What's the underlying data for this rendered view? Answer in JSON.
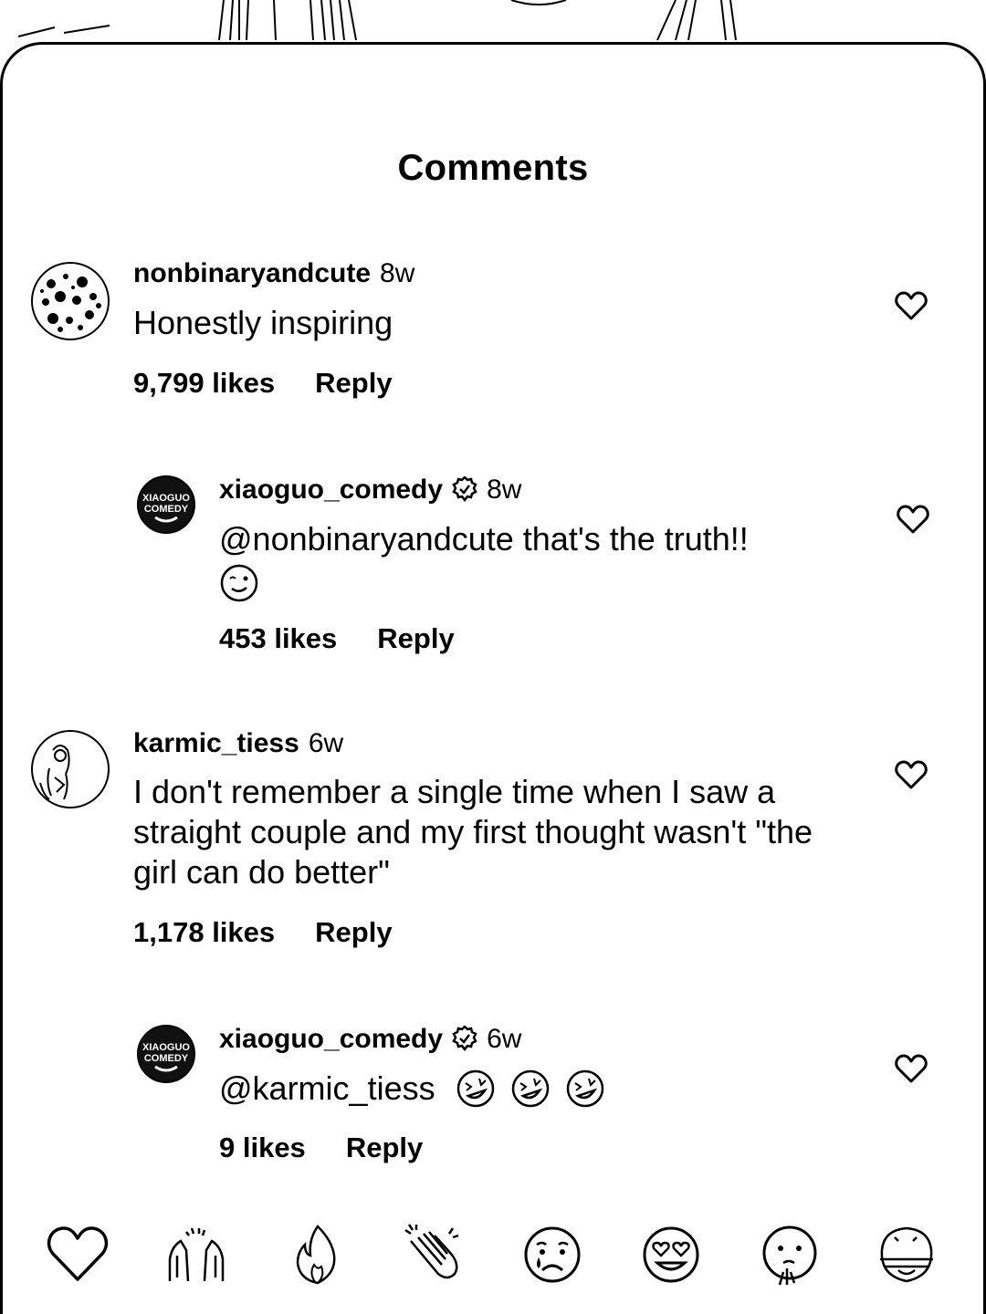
{
  "sheet": {
    "title": "Comments"
  },
  "comments": [
    {
      "username": "nonbinaryandcute",
      "time": "8w",
      "text": "Honestly inspiring",
      "likes": "9,799 likes",
      "reply": "Reply",
      "verified": false
    },
    {
      "username": "xiaoguo_comedy",
      "time": "8w",
      "text": "@nonbinaryandcute that's the truth!!",
      "likes": "453 likes",
      "reply": "Reply",
      "verified": true,
      "emoji": [
        "winking-face"
      ]
    },
    {
      "username": "karmic_tiess",
      "time": "6w",
      "text": "I don't remember a single time when I saw a straight couple and my first thought wasn't \"the girl can do better\"",
      "likes": "1,178 likes",
      "reply": "Reply",
      "verified": false
    },
    {
      "username": "xiaoguo_comedy",
      "time": "6w",
      "text": "@karmic_tiess",
      "likes": "9 likes",
      "reply": "Reply",
      "verified": true,
      "emoji": [
        "rolling-laughing-face",
        "rolling-laughing-face",
        "rolling-laughing-face"
      ]
    }
  ],
  "avatars": {
    "xiaoguo_comedy": {
      "logo_line1": "XIAOGUO",
      "logo_line2": "COMEDY"
    }
  },
  "emoji_bar": [
    "heart",
    "raised-hands",
    "fire",
    "clapping-hands",
    "crying-face",
    "heart-eyes-face",
    "shushing-face",
    "screaming-face"
  ]
}
